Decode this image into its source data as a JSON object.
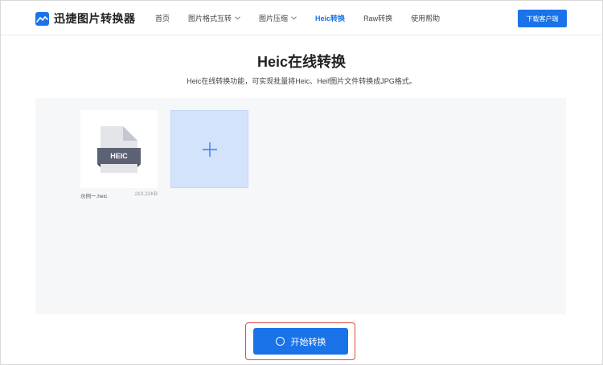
{
  "header": {
    "logo_text": "迅捷图片转换器",
    "nav": [
      {
        "label": "首页",
        "dropdown": false,
        "active": false
      },
      {
        "label": "图片格式互转",
        "dropdown": true,
        "active": false
      },
      {
        "label": "图片压缩",
        "dropdown": true,
        "active": false
      },
      {
        "label": "Heic转换",
        "dropdown": false,
        "active": true
      },
      {
        "label": "Raw转换",
        "dropdown": false,
        "active": false
      },
      {
        "label": "使用帮助",
        "dropdown": false,
        "active": false
      }
    ],
    "download_label": "下载客户端"
  },
  "main": {
    "title": "Heic在线转换",
    "subtitle": "Heic在线转换功能，可实现批量将Heic、Heif图片文件转换成JPG格式。",
    "files": [
      {
        "name": "示例一.heic",
        "size": "210.22KB",
        "type_label": "HEIC"
      }
    ],
    "add_icon": "plus-icon",
    "start_label": "开始转换"
  },
  "colors": {
    "accent": "#1a73e8",
    "add_tile": "#d4e3fc",
    "highlight_outline": "#e04b3f",
    "upload_bg": "#f6f7f9"
  }
}
